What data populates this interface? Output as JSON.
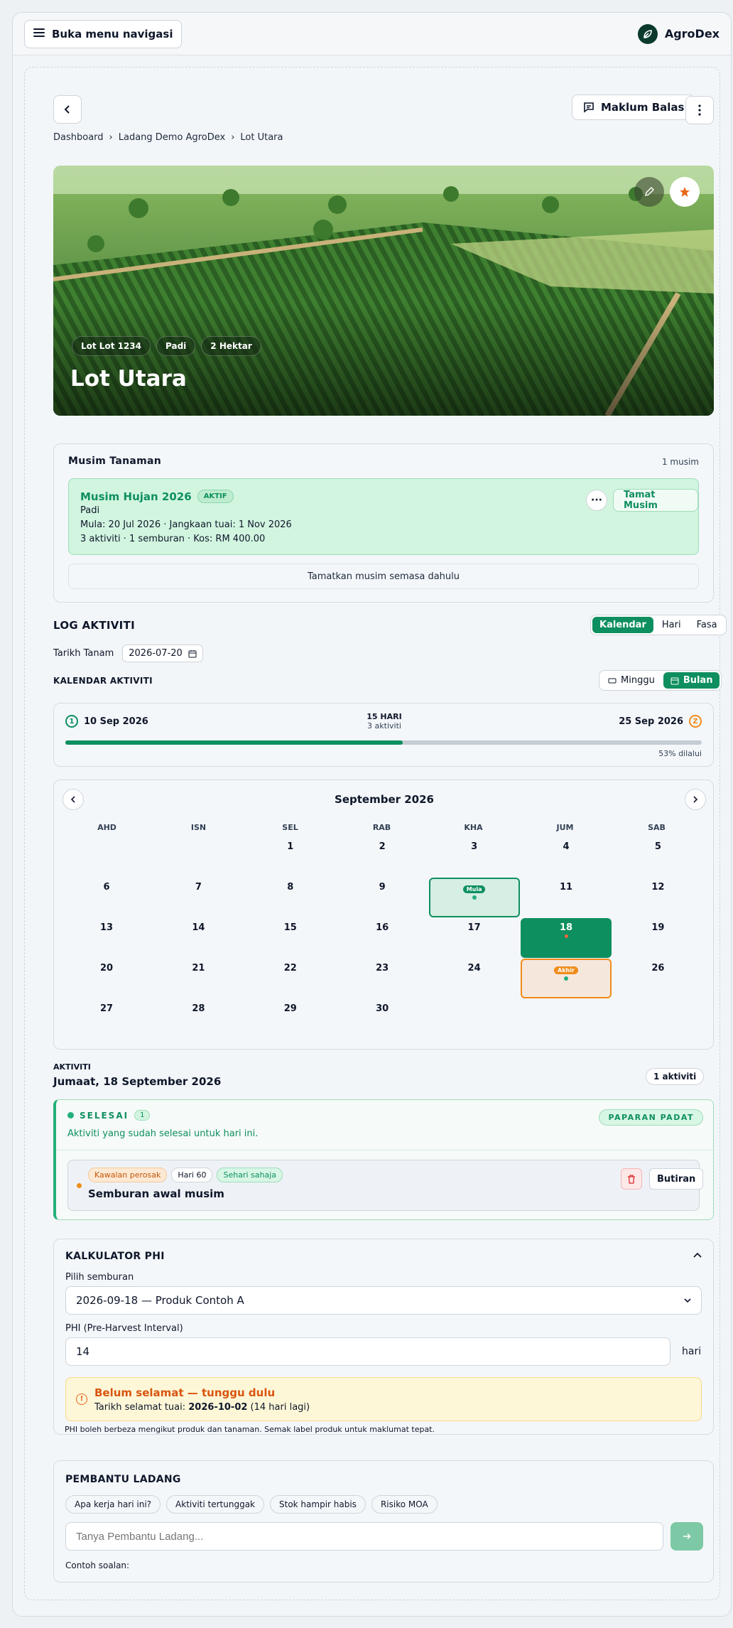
{
  "topbar": {
    "nav_label": "Buka menu navigasi",
    "brand": "AgroDex"
  },
  "header": {
    "feedback_label": "Maklum Balas"
  },
  "breadcrumb": [
    "Dashboard",
    "Ladang Demo AgroDex",
    "Lot Utara"
  ],
  "hero": {
    "chips": [
      "Lot Lot 1234",
      "Padi",
      "2 Hektar"
    ],
    "title": "Lot Utara"
  },
  "season": {
    "title": "Musim Tanaman",
    "count": "1 musim",
    "name": "Musim Hujan 2026",
    "badge": "AKTIF",
    "crop": "Padi",
    "dates": "Mula: 20 Jul 2026 · Jangkaan tuai: 1 Nov 2026",
    "stats": "3 aktiviti · 1 semburan · Kos: RM 400.00",
    "end_label": "Tamat Musim",
    "end_prev_label": "Tamatkan musim semasa dahulu"
  },
  "activity_log": {
    "title": "LOG AKTIVITI",
    "views": [
      "Kalendar",
      "Hari",
      "Fasa"
    ],
    "plant_date_label": "Tarikh Tanam",
    "plant_date_value": "2026-07-20",
    "calendar_title": "KALENDAR AKTIVITI",
    "cal_views": [
      "Minggu",
      "Bulan"
    ]
  },
  "range": {
    "start": "10 Sep 2026",
    "end": "25 Sep 2026",
    "days": "15 HARI",
    "activities": "3 aktiviti",
    "progress": 0.53,
    "progress_label": "53% dilalui"
  },
  "calendar": {
    "month": "September 2026",
    "dow": [
      "AHD",
      "ISN",
      "SEL",
      "RAB",
      "KHA",
      "JUM",
      "SAB"
    ],
    "start_marker": "Mula",
    "end_marker": "Akhir"
  },
  "day": {
    "label": "AKTIVITI",
    "date": "Jumaat, 18 September 2026",
    "count": "1 aktiviti",
    "group": "SELESAI",
    "group_count": "1",
    "dense_label": "PAPARAN PADAT",
    "group_desc": "Aktiviti yang sudah selesai untuk hari ini.",
    "tags": [
      "Kawalan perosak",
      "Hari 60",
      "Sehari sahaja"
    ],
    "item_title": "Semburan awal musim",
    "details_label": "Butiran"
  },
  "phi": {
    "title": "KALKULATOR PHI",
    "spray_label": "Pilih semburan",
    "spray_value": "2026-09-18 — Produk Contoh A",
    "phi_label": "PHI (Pre-Harvest Interval)",
    "phi_value": "14",
    "phi_unit": "hari",
    "warn_title": "Belum selamat — tunggu dulu",
    "warn_prefix": "Tarikh selamat tuai: ",
    "warn_date": "2026-10-02",
    "warn_suffix": " (14 hari lagi)",
    "note": "PHI boleh berbeza mengikut produk dan tanaman. Semak label produk untuk maklumat tepat."
  },
  "assistant": {
    "title": "PEMBANTU LADANG",
    "suggestions": [
      "Apa kerja hari ini?",
      "Aktiviti tertunggak",
      "Stok hampir habis",
      "Risiko MOA"
    ],
    "placeholder": "Tanya Pembantu Ladang...",
    "examples_label": "Contoh soalan:"
  },
  "colors": {
    "accent": "#0e8f5f",
    "orange": "#f08c1a",
    "danger": "#dc2626"
  }
}
